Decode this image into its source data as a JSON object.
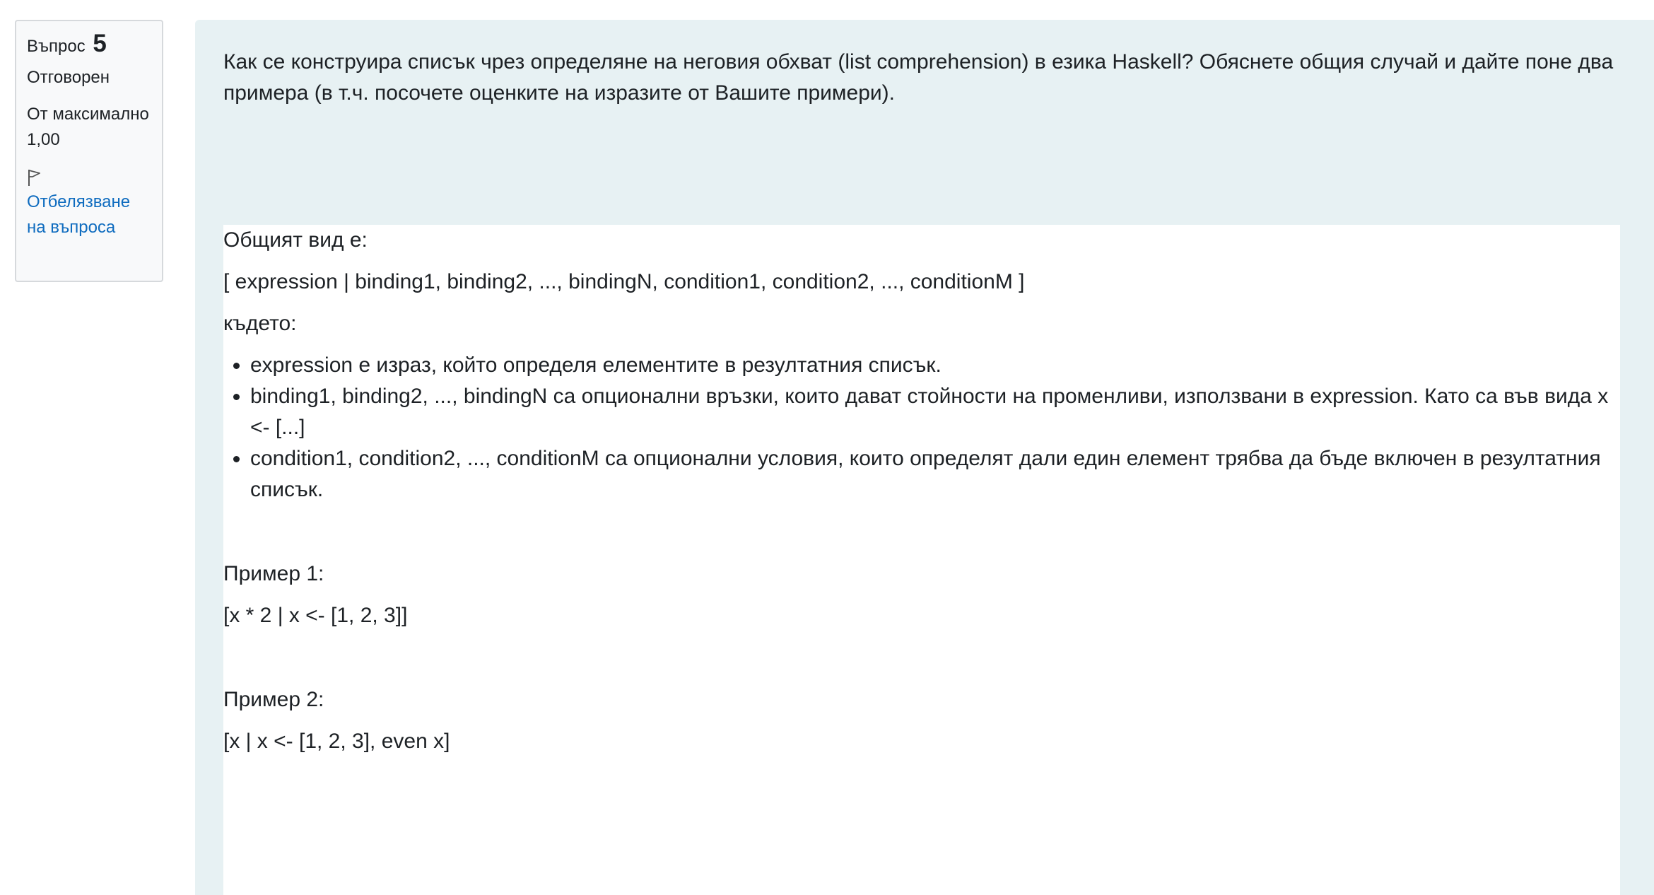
{
  "info": {
    "question_label": "Въпрос",
    "question_number": "5",
    "state": "Отговорен",
    "grade": "От максимално 1,00",
    "flag_label": "Отбелязване на въпроса"
  },
  "question": {
    "text": "Как се конструира списък чрез определяне на неговия обхват (list comprehension) в езика Haskell? Обяснете общия случай и дайте поне два примера (в т.ч. посочете оценките на изразите от Вашите примери)."
  },
  "answer": {
    "intro": "Общият вид е:",
    "syntax": "[ expression | binding1, binding2, ..., bindingN, condition1, condition2, ..., conditionM ]",
    "where": "където:",
    "bullets": [
      "expression е израз, който определя елементите в резултатния списък.",
      "binding1, binding2, ..., bindingN са опционални връзки, които дават стойности на променливи, използвани в expression. Като са във вида x <- [...]",
      "condition1, condition2, ..., conditionM са опционални условия, които определят дали един елемент трябва да бъде включен в резултатния списък."
    ],
    "example1_title": "Пример 1:",
    "example1_code": "[x * 2 | x <- [1, 2, 3]]",
    "example2_title": "Пример 2:",
    "example2_code": "[x | x <- [1, 2, 3], even x]"
  }
}
